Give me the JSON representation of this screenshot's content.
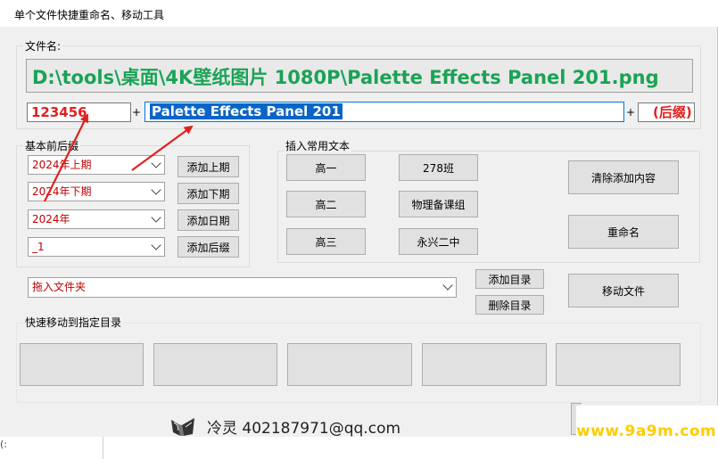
{
  "window": {
    "title": "单个文件快捷重命名、移动工具"
  },
  "filename": {
    "label": "文件名:",
    "full_path": "D:\\tools\\桌面\\4K壁纸图片 1080P\\Palette Effects Panel 201.png",
    "prefix_value": "123456",
    "name_value": "Palette Effects Panel 201",
    "suffix_value": "(后缀)",
    "plus": "+"
  },
  "basic": {
    "label": "基本前后缀",
    "rows": [
      {
        "value": "2024年上期",
        "button": "添加上期"
      },
      {
        "value": "2024年下期",
        "button": "添加下期"
      },
      {
        "value": "2024年",
        "button": "添加日期"
      },
      {
        "value": "_1",
        "button": "添加后缀"
      }
    ]
  },
  "insert": {
    "label": "插入常用文本",
    "buttons": [
      "高一",
      "278班",
      "高二",
      "物理备课组",
      "高三",
      "永兴二中"
    ],
    "clear_button": "清除添加内容",
    "rename_button": "重命名"
  },
  "folder": {
    "value": "拖入文件夹",
    "add_dir_button": "添加目录",
    "del_dir_button": "删除目录",
    "move_button": "移动文件"
  },
  "quick_move": {
    "label": "快速移动到指定目录",
    "slots": 5
  },
  "footer": {
    "credit": "冷灵 402187971@qq.com"
  },
  "watermark": {
    "text": "www.9a9m.com"
  },
  "bottom": {
    "fragment": "(:"
  },
  "colors": {
    "path_green": "#1aa356",
    "value_red": "#c00000",
    "selection_blue": "#0a64c8",
    "arrow_red": "#e02020",
    "watermark_yellow": "#ffcc00"
  }
}
